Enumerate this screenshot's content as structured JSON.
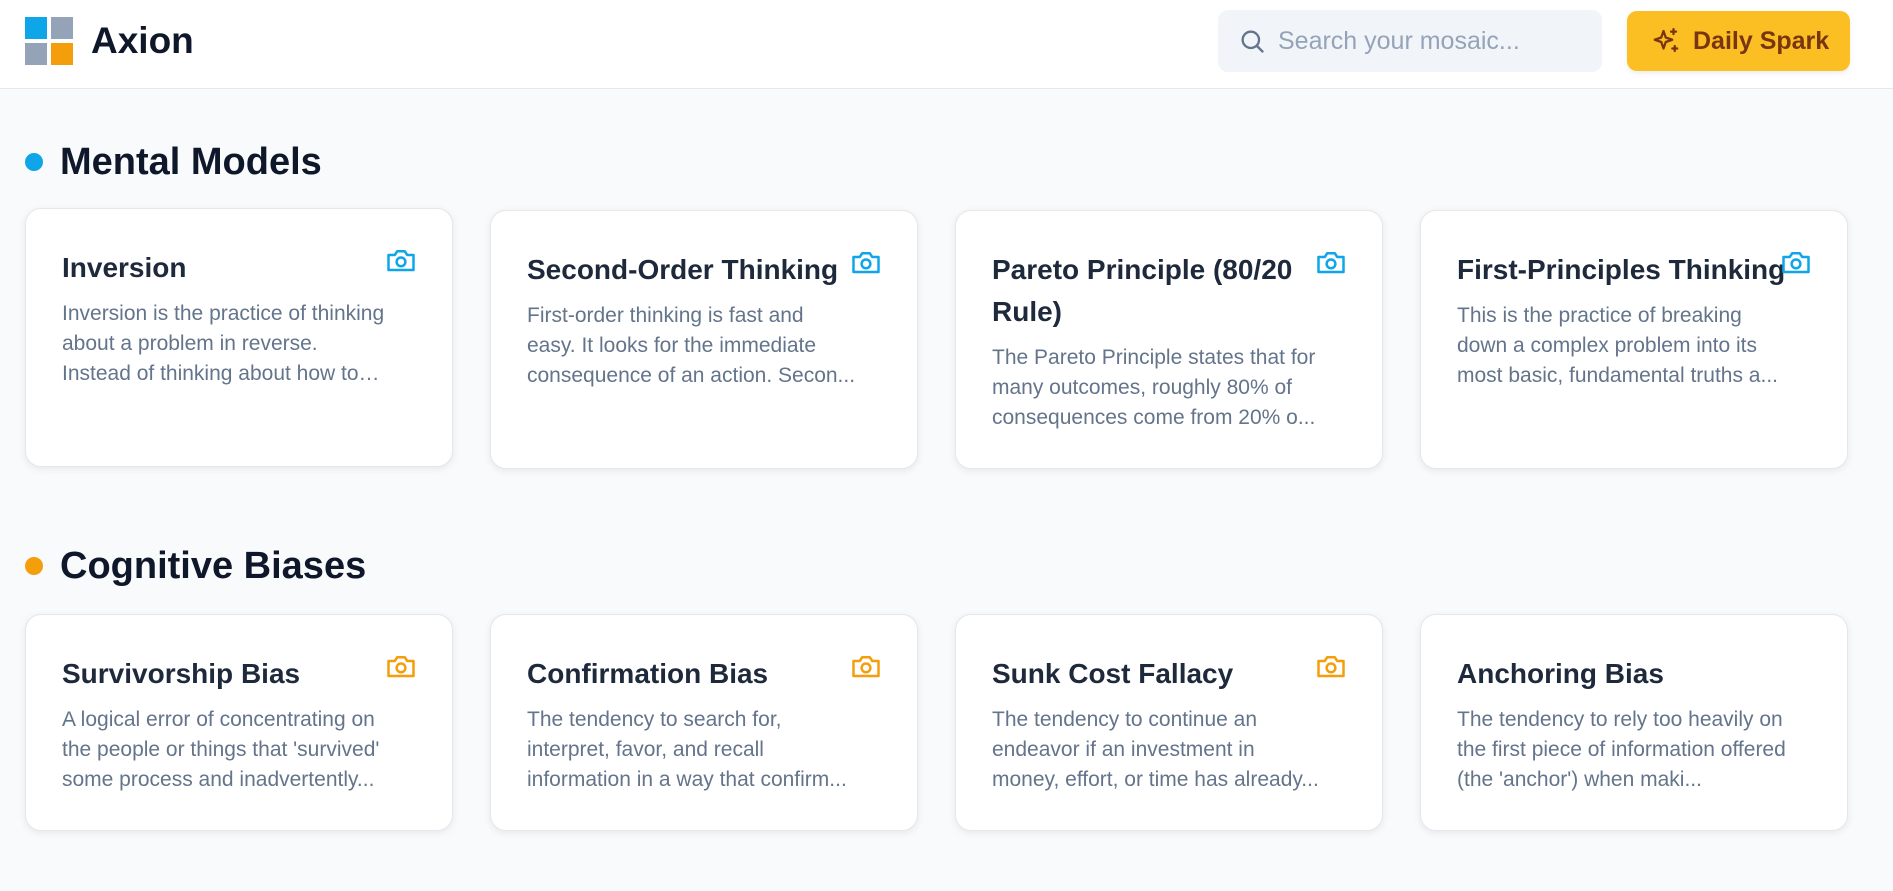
{
  "header": {
    "brand": "Axion",
    "search_placeholder": "Search your mosaic...",
    "spark_label": "Daily Spark"
  },
  "colors": {
    "accent_blue": "#0ea5e9",
    "accent_amber": "#f59e0b",
    "button_yellow": "#fbbf24"
  },
  "sections": [
    {
      "title": "Mental Models",
      "dot_color": "#0ea5e9",
      "cards": [
        {
          "title": "Inversion",
          "desc": "Inversion is the practice of thinking about a problem in reverse. Instead of thinking about how to achieve ...",
          "icon": "camera-icon"
        },
        {
          "title": "Second-Order Thinking",
          "desc": "First-order thinking is fast and easy. It looks for the immediate consequence of an action. Secon...",
          "icon": "camera-icon"
        },
        {
          "title": "Pareto Principle (80/20 Rule)",
          "desc": "The Pareto Principle states that for many outcomes, roughly 80% of consequences come from 20% o...",
          "icon": "camera-icon"
        },
        {
          "title": "First-Principles Thinking",
          "desc": "This is the practice of breaking down a complex problem into its most basic, fundamental truths a...",
          "icon": "camera-icon"
        }
      ]
    },
    {
      "title": "Cognitive Biases",
      "dot_color": "#f59e0b",
      "cards": [
        {
          "title": "Survivorship Bias",
          "desc": "A logical error of concentrating on the people or things that 'survived' some process and inadvertently...",
          "icon": "camera-icon"
        },
        {
          "title": "Confirmation Bias",
          "desc": "The tendency to search for, interpret, favor, and recall information in a way that confirm...",
          "icon": "camera-icon"
        },
        {
          "title": "Sunk Cost Fallacy",
          "desc": "The tendency to continue an endeavor if an investment in money, effort, or time has already...",
          "icon": "camera-icon"
        },
        {
          "title": "Anchoring Bias",
          "desc": "The tendency to rely too heavily on the first piece of information offered (the 'anchor') when maki...",
          "icon": null
        }
      ]
    }
  ]
}
